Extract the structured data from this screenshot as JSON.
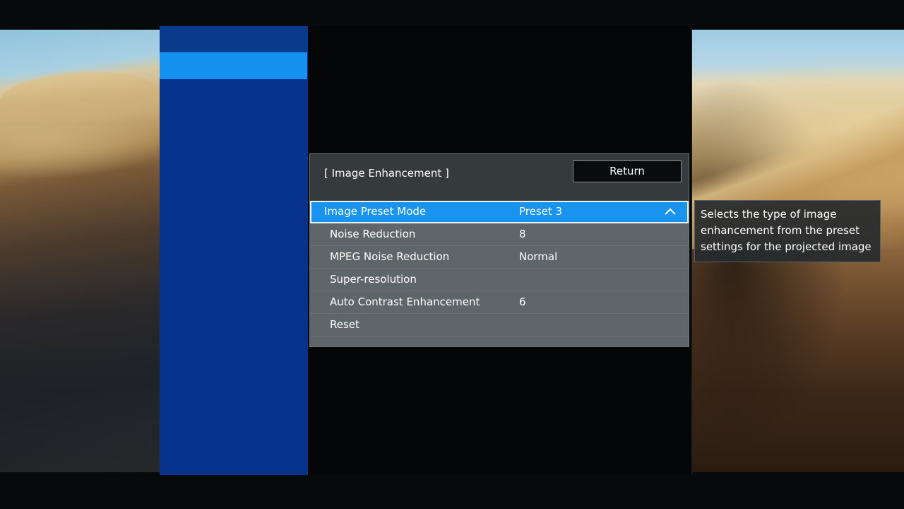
{
  "submenu": {
    "title": "[ Image Enhancement ]",
    "return_label": "Return",
    "rows": [
      {
        "label": "Image Preset Mode",
        "value": "Preset 3"
      },
      {
        "label": "Noise Reduction",
        "value": "8"
      },
      {
        "label": "MPEG Noise Reduction",
        "value": "Normal"
      },
      {
        "label": "Super-resolution",
        "value": ""
      },
      {
        "label": "Auto Contrast Enhancement",
        "value": "6"
      },
      {
        "label": "Reset",
        "value": ""
      }
    ],
    "selected_icon": "chevron-up-icon"
  },
  "help_text": "Selects the type of image enhancement from the preset settings for the projected image",
  "colors": {
    "sidebar": "#07338c",
    "sidebar_selected": "#1591ef",
    "row_selected": "#1a93ee",
    "row_background": "#5e6669",
    "dialog_background": "#353a3d"
  }
}
